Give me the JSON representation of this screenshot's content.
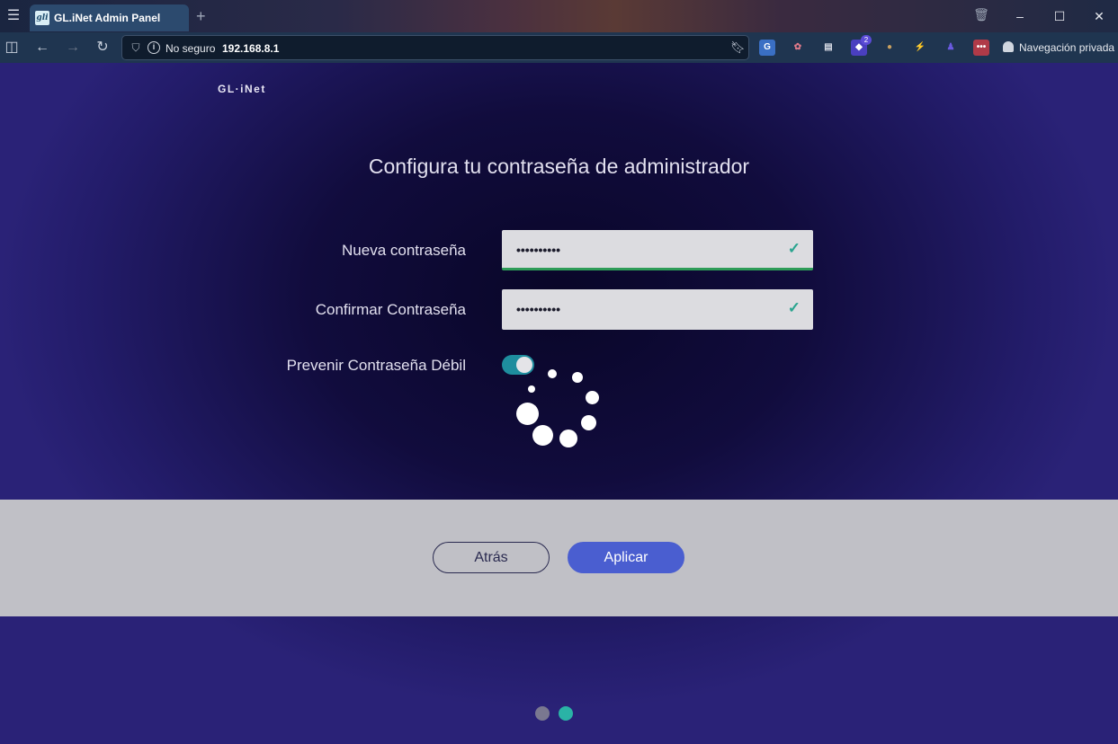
{
  "browser": {
    "tab_title": "GL.iNet Admin Panel",
    "tab_favicon_text": "gli",
    "new_tab": "+",
    "url_security": "No seguro",
    "url_address": "192.168.8.1",
    "extension_badge": "2",
    "private_label": "Navegación privada",
    "icons": [
      "menu-icon",
      "sidebar-icon",
      "back-icon",
      "forward-icon",
      "reload-icon",
      "shield-icon",
      "info-icon",
      "bookmark-icon",
      "trash-icon",
      "minimize-icon",
      "maximize-icon",
      "close-icon"
    ]
  },
  "page": {
    "logo": "GL·iNet",
    "heading": "Configura tu contraseña de administrador",
    "new_password_label": "Nueva contraseña",
    "new_password_value": "••••••••••",
    "confirm_password_label": "Confirmar Contraseña",
    "confirm_password_value": "••••••••••",
    "prevent_weak_label": "Prevenir Contraseña Débil",
    "prevent_weak_enabled": true,
    "back_button": "Atrás",
    "apply_button": "Aplicar",
    "pager_total": 2,
    "pager_active": 2
  },
  "colors": {
    "page_bg": "#1d1a55",
    "accent": "#4a5ed0",
    "toggle_on": "#1e8d9e",
    "check": "#2aa48f",
    "pager_active": "#2ab3a6",
    "pager_inactive": "#7a7890"
  }
}
